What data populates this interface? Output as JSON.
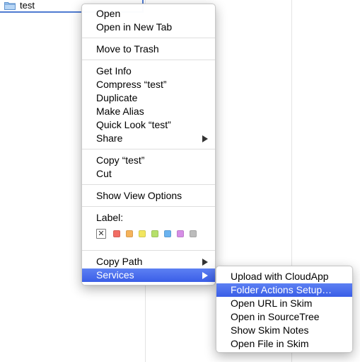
{
  "file": {
    "name": "test",
    "icon": "folder-icon"
  },
  "context_menu": {
    "group1": [
      "Open",
      "Open in New Tab"
    ],
    "group2": [
      "Move to Trash"
    ],
    "group3": [
      "Get Info",
      "Compress “test”",
      "Duplicate",
      "Make Alias",
      "Quick Look “test”",
      "Share"
    ],
    "group4": [
      "Copy “test”",
      "Cut"
    ],
    "group5": [
      "Show View Options"
    ],
    "label_title": "Label:",
    "label_colors": [
      "#f26d64",
      "#f6b35b",
      "#f2e65f",
      "#b6e06a",
      "#6ab3f0",
      "#d68ee6",
      "#bcbcbc"
    ],
    "group6": [
      "Copy Path",
      "Services"
    ],
    "highlight_color": "#3d62e9"
  },
  "services_menu": {
    "items": [
      "Upload with CloudApp",
      "Folder Actions Setup…",
      "Open URL in Skim",
      "Open in SourceTree",
      "Show Skim Notes",
      "Open File in Skim"
    ],
    "highlighted_index": 1
  }
}
